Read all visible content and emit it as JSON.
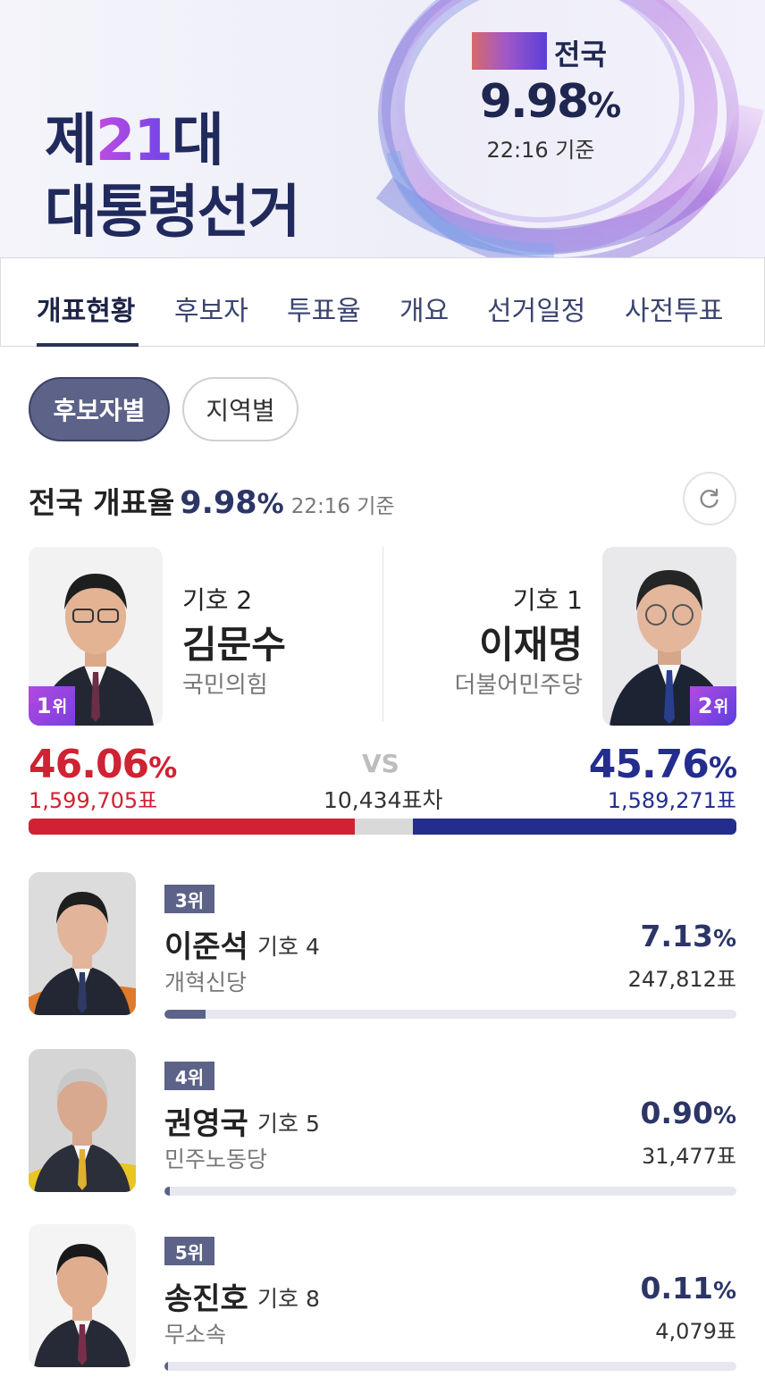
{
  "header": {
    "title_prefix": "제",
    "title_number": "21",
    "title_suffix": "대",
    "title_line2": "대통령선거",
    "national_label": "전국",
    "national_rate": "9.98",
    "national_rate_unit": "%",
    "as_of": "22:16 기준"
  },
  "tabs": [
    {
      "label": "개표현황",
      "active": true
    },
    {
      "label": "후보자",
      "active": false
    },
    {
      "label": "투표율",
      "active": false
    },
    {
      "label": "개요",
      "active": false
    },
    {
      "label": "선거일정",
      "active": false
    },
    {
      "label": "사전투표",
      "active": false
    }
  ],
  "filters": {
    "by_candidate": "후보자별",
    "by_region": "지역별"
  },
  "summary": {
    "label": "전국 개표율",
    "rate": "9.98",
    "rate_unit": "%",
    "as_of": "22:16 기준"
  },
  "top_two": {
    "left": {
      "rank": "1",
      "rank_unit": "위",
      "symbol": "기호 2",
      "name": "김문수",
      "party": "국민의힘",
      "pct": "46.06",
      "pct_unit": "%",
      "votes": "1,599,705표",
      "color": "#cf2232",
      "share": 46.06
    },
    "right": {
      "rank": "2",
      "rank_unit": "위",
      "symbol": "기호 1",
      "name": "이재명",
      "party": "더불어민주당",
      "pct": "45.76",
      "pct_unit": "%",
      "votes": "1,589,271표",
      "color": "#232d8e",
      "share": 45.76
    },
    "vs_label": "VS",
    "difference": "10,434표차"
  },
  "others": [
    {
      "rank": "3위",
      "name": "이준석",
      "symbol": "기호 4",
      "party": "개혁신당",
      "pct": "7.13",
      "pct_unit": "%",
      "votes": "247,812표",
      "share": 7.13
    },
    {
      "rank": "4위",
      "name": "권영국",
      "symbol": "기호 5",
      "party": "민주노동당",
      "pct": "0.90",
      "pct_unit": "%",
      "votes": "31,477표",
      "share": 0.9
    },
    {
      "rank": "5위",
      "name": "송진호",
      "symbol": "기호 8",
      "party": "무소속",
      "pct": "0.11",
      "pct_unit": "%",
      "votes": "4,079표",
      "share": 0.11
    }
  ],
  "colors": {
    "navy": "#2c3566",
    "accent": "#5c6288",
    "red": "#cf2232",
    "blue": "#232d8e"
  },
  "icons": {
    "refresh": "refresh-icon"
  }
}
